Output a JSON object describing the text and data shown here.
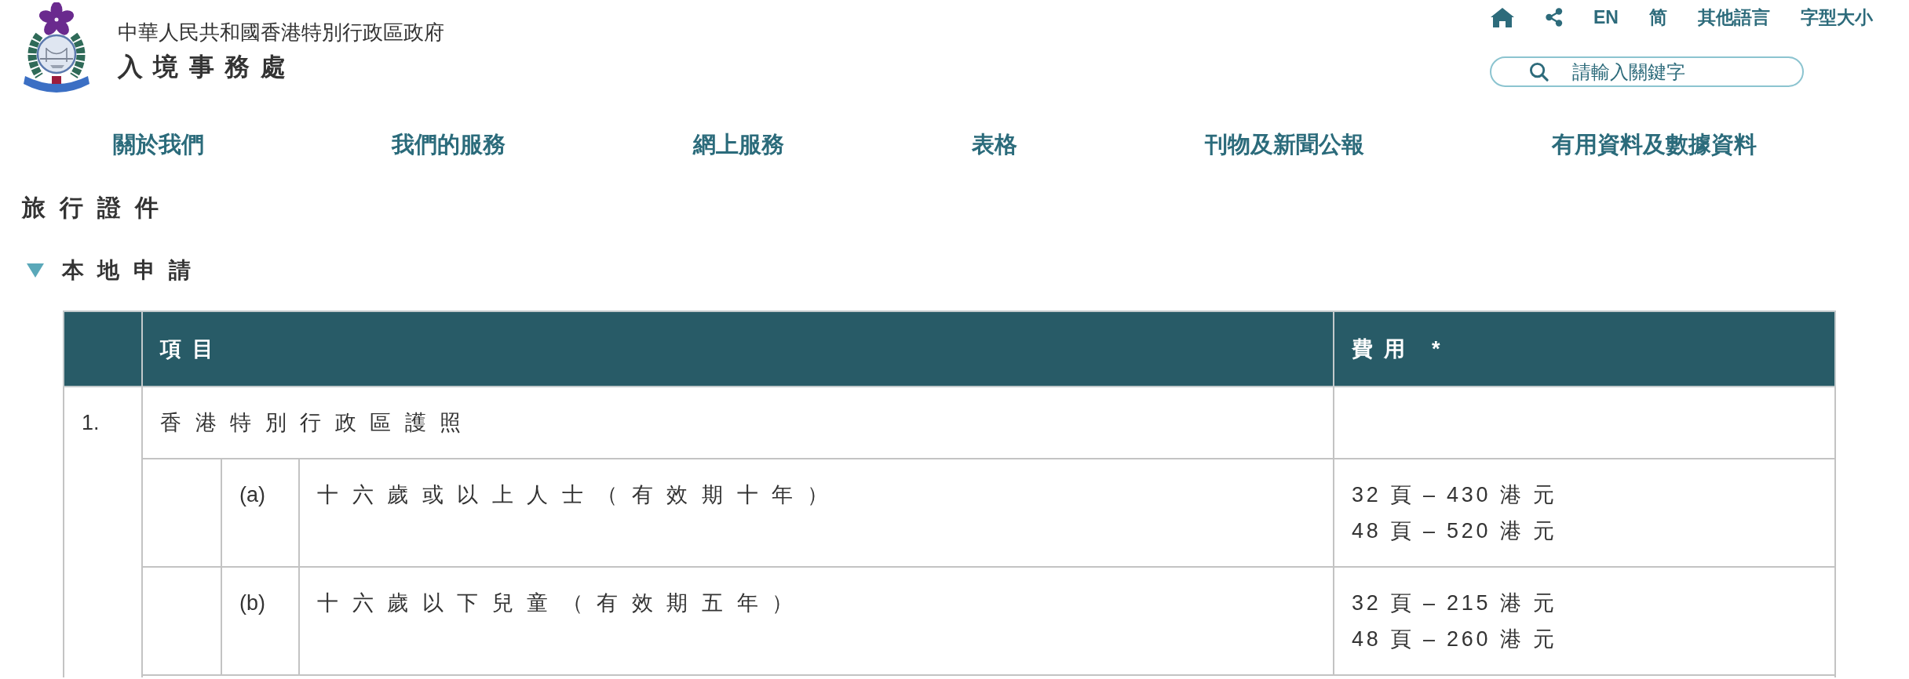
{
  "header": {
    "government": "中華人民共和國香港特別行政區政府",
    "department": "入境事務處"
  },
  "utility_links": [
    "EN",
    "简",
    "其他語言",
    "字型大小"
  ],
  "search": {
    "placeholder": "請輸入關鍵字"
  },
  "nav": [
    "關於我們",
    "我們的服務",
    "網上服務",
    "表格",
    "刊物及新聞公報",
    "有用資料及數據資料"
  ],
  "page_title": "旅行證件",
  "section": {
    "title": "本地申請",
    "expanded": true
  },
  "table": {
    "columns": [
      "項目",
      "費用 *"
    ],
    "rows": [
      {
        "number": "1.",
        "item": "香港特別行政區護照",
        "subitems": [
          {
            "label": "(a)",
            "item": "十六歲或以上人士（有效期十年）",
            "fee": [
              "32 頁 – 430 港 元",
              "48 頁 – 520 港 元"
            ]
          },
          {
            "label": "(b)",
            "item": "十六歲以下兒童（有效期五年）",
            "fee": [
              "32 頁 – 215 港 元",
              "48 頁 – 260 港 元"
            ]
          }
        ]
      }
    ]
  }
}
